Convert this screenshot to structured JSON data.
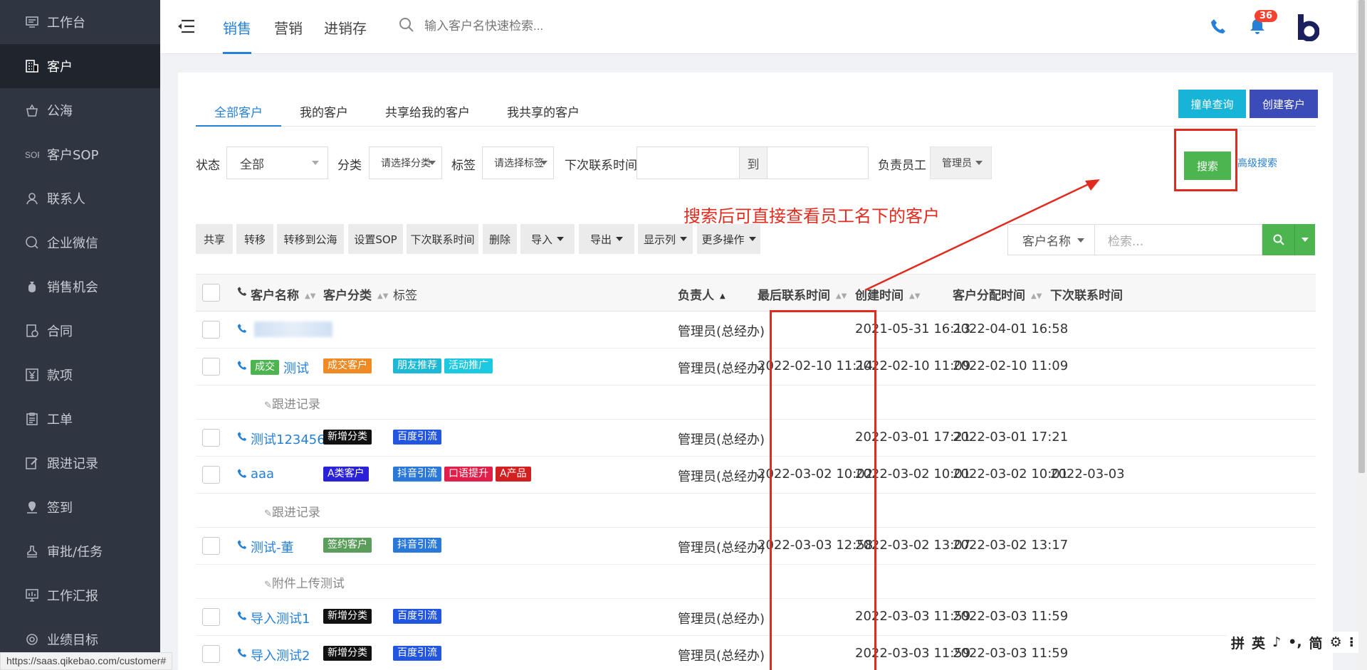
{
  "sidebar": {
    "items": [
      {
        "label": "工作台",
        "icon": "monitor-icon"
      },
      {
        "label": "客户",
        "icon": "building-icon",
        "active": true
      },
      {
        "label": "公海",
        "icon": "basket-icon"
      },
      {
        "label": "客户SOP",
        "icon": "sop-icon"
      },
      {
        "label": "联系人",
        "icon": "person-icon"
      },
      {
        "label": "企业微信",
        "icon": "chat-icon"
      },
      {
        "label": "销售机会",
        "icon": "moneybag-icon"
      },
      {
        "label": "合同",
        "icon": "contract-icon"
      },
      {
        "label": "款项",
        "icon": "yuan-icon"
      },
      {
        "label": "工单",
        "icon": "clipboard-icon"
      },
      {
        "label": "跟进记录",
        "icon": "edit-icon"
      },
      {
        "label": "签到",
        "icon": "location-icon"
      },
      {
        "label": "审批/任务",
        "icon": "stamp-icon"
      },
      {
        "label": "工作汇报",
        "icon": "report-icon"
      },
      {
        "label": "业绩目标",
        "icon": "target-icon"
      }
    ]
  },
  "topbar": {
    "tabs": [
      "销售",
      "营销",
      "进销存"
    ],
    "search_placeholder": "输入客户名快速检索...",
    "notification_count": "36"
  },
  "customer_tabs": [
    "全部客户",
    "我的客户",
    "共享给我的客户",
    "我共享的客户"
  ],
  "buttons": {
    "quick_check": "撞单查询",
    "create_customer": "创建客户",
    "search": "搜索",
    "advanced_search": "高级搜索"
  },
  "filters": {
    "status_label": "状态",
    "status_value": "全部",
    "category_label": "分类",
    "category_value": "请选择分类",
    "tag_label": "标签",
    "tag_value": "请选择标签",
    "next_contact_label": "下次联系时间",
    "to_label": "到",
    "owner_label": "负责员工",
    "owner_value": "管理员"
  },
  "annotation": "搜索后可直接查看员工名下的客户",
  "actions": [
    "共享",
    "转移",
    "转移到公海",
    "设置SOP",
    "下次联系时间",
    "删除",
    "导入",
    "导出",
    "显示列",
    "更多操作"
  ],
  "table_search": {
    "field": "客户名称",
    "placeholder": "检索..."
  },
  "table": {
    "columns": [
      "客户名称",
      "客户分类",
      "标签",
      "负责人",
      "最后联系时间",
      "创建时间",
      "客户分配时间",
      "下次联系时间"
    ],
    "rows": [
      {
        "name": "",
        "status_tag": "",
        "category": null,
        "tags": [],
        "owner": "管理员(总经办)",
        "last_contact": "",
        "created": "2021-05-31 16:13",
        "assigned": "2022-04-01 16:58",
        "next_contact": "",
        "sub": ""
      },
      {
        "name": "测试",
        "status_tag": "成交",
        "category": {
          "text": "成交客户",
          "color": "#f08a24"
        },
        "tags": [
          {
            "text": "朋友推荐",
            "color": "#1cb8d6"
          },
          {
            "text": "活动推广",
            "color": "#1cc9e0"
          }
        ],
        "owner": "管理员(总经办)",
        "last_contact": "2022-02-10 11:14",
        "created": "2022-02-10 11:09",
        "assigned": "2022-02-10 11:09",
        "next_contact": "",
        "sub": "跟进记录"
      },
      {
        "name": "测试123456",
        "status_tag": "",
        "category": {
          "text": "新增分类",
          "color": "#111111"
        },
        "tags": [
          {
            "text": "百度引流",
            "color": "#2256e0"
          }
        ],
        "owner": "管理员(总经办)",
        "last_contact": "",
        "created": "2022-03-01 17:21",
        "assigned": "2022-03-01 17:21",
        "next_contact": "",
        "sub": ""
      },
      {
        "name": "aaa",
        "status_tag": "",
        "category": {
          "text": "A类客户",
          "color": "#2a22d8"
        },
        "tags": [
          {
            "text": "抖音引流",
            "color": "#2a78d8"
          },
          {
            "text": "口语提升",
            "color": "#e0204a"
          },
          {
            "text": "A产品",
            "color": "#d22020"
          }
        ],
        "owner": "管理员(总经办)",
        "last_contact": "2022-03-02 10:02",
        "created": "2022-03-02 10:01",
        "assigned": "2022-03-02 10:01",
        "next_contact": "2022-03-03",
        "sub": "跟进记录"
      },
      {
        "name": "测试-董",
        "status_tag": "",
        "category": {
          "text": "签约客户",
          "color": "#5b9e5b"
        },
        "tags": [
          {
            "text": "抖音引流",
            "color": "#2a78d8"
          }
        ],
        "owner": "管理员(总经办)",
        "last_contact": "2022-03-03 12:58",
        "created": "2022-03-02 13:07",
        "assigned": "2022-03-02 13:17",
        "next_contact": "",
        "sub": "附件上传测试"
      },
      {
        "name": "导入测试1",
        "status_tag": "",
        "category": {
          "text": "新增分类",
          "color": "#111111"
        },
        "tags": [
          {
            "text": "百度引流",
            "color": "#2256e0"
          }
        ],
        "owner": "管理员(总经办)",
        "last_contact": "",
        "created": "2022-03-03 11:59",
        "assigned": "2022-03-03 11:59",
        "next_contact": "",
        "sub": ""
      },
      {
        "name": "导入测试2",
        "status_tag": "",
        "category": {
          "text": "新增分类",
          "color": "#111111"
        },
        "tags": [
          {
            "text": "百度引流",
            "color": "#2256e0"
          }
        ],
        "owner": "管理员(总经办)",
        "last_contact": "",
        "created": "2022-03-03 11:59",
        "assigned": "2022-03-03 11:59",
        "next_contact": "",
        "sub": ""
      }
    ]
  },
  "status_bar_url": "https://saas.qikebao.com/customer#",
  "ime": [
    "拼",
    "英",
    "♪",
    "•,",
    "简",
    "⚙",
    "⁝"
  ]
}
